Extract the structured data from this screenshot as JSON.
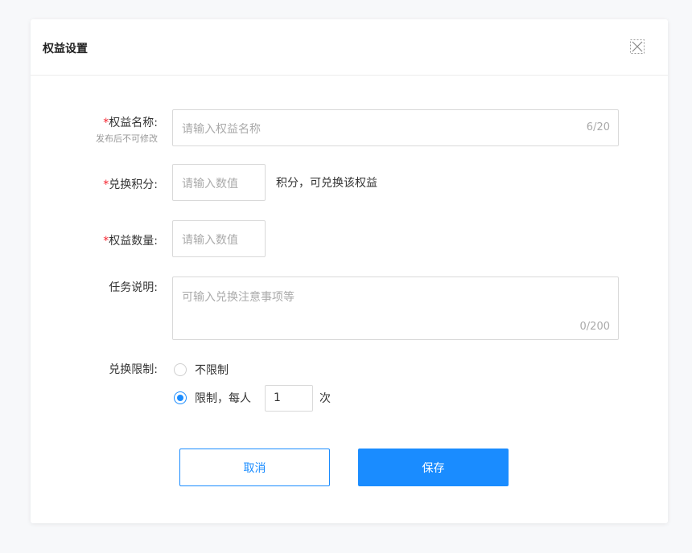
{
  "dialog": {
    "title": "权益设置",
    "close_icon": "close-icon"
  },
  "form": {
    "name": {
      "required_mark": "*",
      "label": "权益名称:",
      "sub_label": "发布后不可修改",
      "placeholder": "请输入权益名称",
      "counter": "6/20"
    },
    "points": {
      "required_mark": "*",
      "label": "兑换积分:",
      "placeholder": "请输入数值",
      "suffix": "积分，可兑换该权益"
    },
    "quantity": {
      "required_mark": "*",
      "label": "权益数量:",
      "placeholder": "请输入数值"
    },
    "description": {
      "label": "任务说明:",
      "placeholder": "可输入兑换注意事项等",
      "counter": "0/200"
    },
    "limit": {
      "label": "兑换限制:",
      "options": [
        {
          "label": "不限制",
          "checked": false
        },
        {
          "label": "限制，每人",
          "checked": true
        }
      ],
      "per_person_value": "1",
      "unit": "次"
    }
  },
  "actions": {
    "cancel_label": "取消",
    "save_label": "保存"
  },
  "colors": {
    "accent": "#1a8cff",
    "required": "#f5222d"
  }
}
